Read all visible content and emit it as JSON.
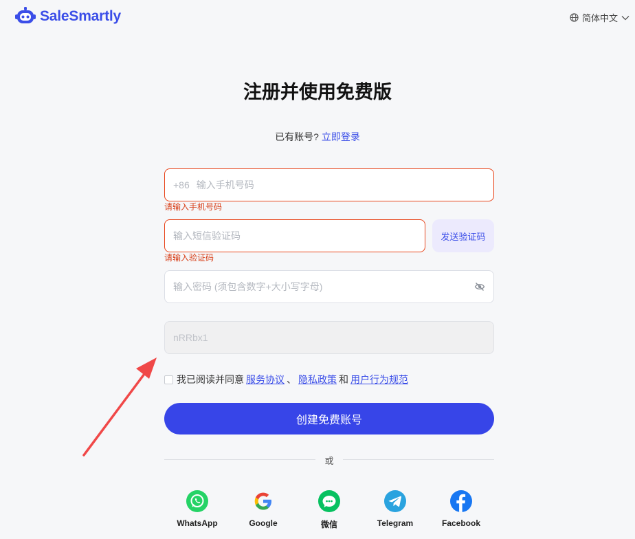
{
  "brand": {
    "name": "SaleSmartly",
    "color": "#3b4ee8"
  },
  "language": {
    "label": "简体中文",
    "icon": "globe-icon"
  },
  "page": {
    "title": "注册并使用免费版"
  },
  "login": {
    "prompt": "已有账号?",
    "link": "立即登录"
  },
  "form": {
    "phone": {
      "prefix": "+86",
      "placeholder": "输入手机号码",
      "value": "",
      "error": "请输入手机号码"
    },
    "sms": {
      "placeholder": "输入短信验证码",
      "value": "",
      "error": "请输入验证码",
      "send_label": "发送验证码"
    },
    "password": {
      "placeholder": "输入密码 (须包含数字+大小写字母)",
      "value": "",
      "toggle_icon": "eye-off-icon"
    },
    "captcha": {
      "text": "nRRbx1"
    },
    "agreement": {
      "prefix": "我已阅读并同意",
      "terms": "服务协议",
      "sep": "、",
      "privacy": "隐私政策",
      "and": "和",
      "conduct": "用户行为规范",
      "checked": false
    },
    "submit_label": "创建免费账号"
  },
  "divider": {
    "label": "或"
  },
  "social": [
    {
      "label": "WhatsApp",
      "icon": "whatsapp-icon",
      "color": "#25d366"
    },
    {
      "label": "Google",
      "icon": "google-icon",
      "color": "#4285f4"
    },
    {
      "label": "微信",
      "icon": "wechat-icon",
      "color": "#07c160"
    },
    {
      "label": "Telegram",
      "icon": "telegram-icon",
      "color": "#2aa3df"
    },
    {
      "label": "Facebook",
      "icon": "facebook-icon",
      "color": "#1877f2"
    }
  ],
  "annotation": {
    "icon": "red-arrow-icon",
    "color": "#f04848"
  }
}
